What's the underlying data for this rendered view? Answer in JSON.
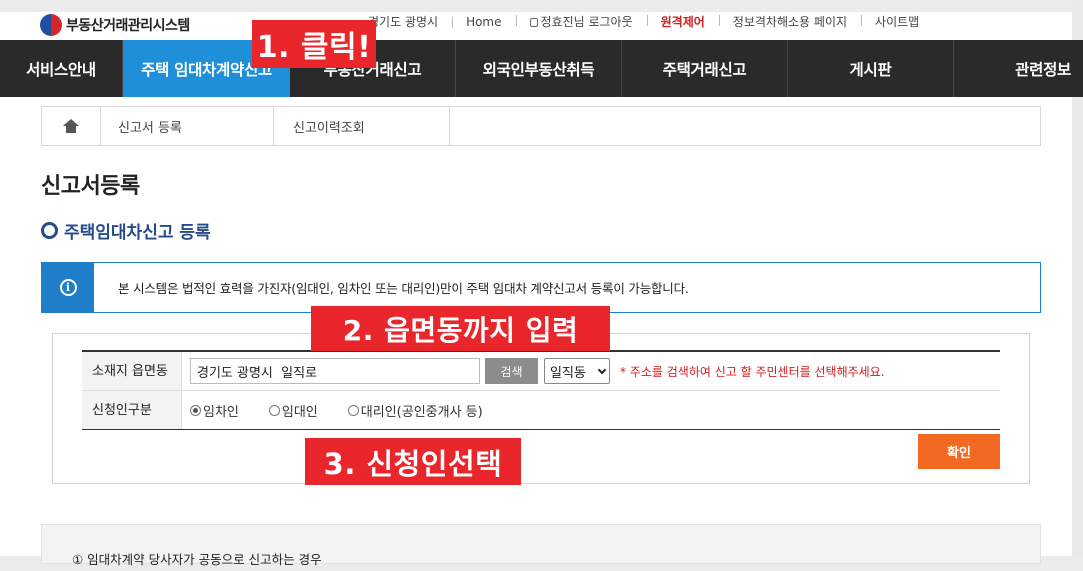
{
  "site": {
    "logo_text": "부동산거래관리시스템",
    "logo_icon": "taegeuk-logo-icon"
  },
  "utility": {
    "region": "경기도 광명시",
    "home": "Home",
    "user_logout": "정효진님 로그아웃",
    "remote_control": "원격제어",
    "info_page": "정보격차해소용 페이지",
    "sitemap": "사이트맵"
  },
  "nav": {
    "items": [
      {
        "label": "서비스안내"
      },
      {
        "label": "주택 임대차계약신고"
      },
      {
        "label": "부동산거래신고"
      },
      {
        "label": "외국인부동산취득"
      },
      {
        "label": "주택거래신고"
      },
      {
        "label": "게시판"
      },
      {
        "label": "관련정보"
      }
    ],
    "active_index": 1
  },
  "breadcrumb": {
    "home_icon": "home-icon",
    "tab1": "신고서 등록",
    "tab2": "신고이력조회"
  },
  "page_title": "신고서등록",
  "section_title": "주택임대차신고 등록",
  "info": {
    "icon": "info-icon",
    "text": "본 시스템은 법적인 효력을 가진자(임대인, 임차인 또는 대리인)만이 주택 임대차 계약신고서 등록이 가능합니다."
  },
  "form": {
    "address_label": "소재지 읍면동",
    "address_value": "경기도 광명시  일직로",
    "search_button": "검색",
    "dong_selected": "일직동",
    "address_hint": "* 주소를 검색하여 신고 할 주민센터를 선택해주세요.",
    "applicant_label": "신청인구분",
    "applicant_options": [
      "임차인",
      "임대인",
      "대리인(공인중개사 등)"
    ],
    "applicant_selected": 0,
    "confirm_button": "확인"
  },
  "note": {
    "text": "① 임대차계약 당사자가 공동으로 신고하는 경우"
  },
  "annotations": {
    "step1": "1. 클릭!",
    "step2": "2. 읍면동까지 입력",
    "step3": "3. 신청인선택"
  },
  "colors": {
    "nav_bg": "#2a2a2a",
    "nav_active": "#1e8fd8",
    "section_title": "#274a8a",
    "info_accent": "#1e7fc8",
    "confirm_button": "#f26a22",
    "annotation": "#e8262c",
    "remote_control": "#d21e1e"
  }
}
